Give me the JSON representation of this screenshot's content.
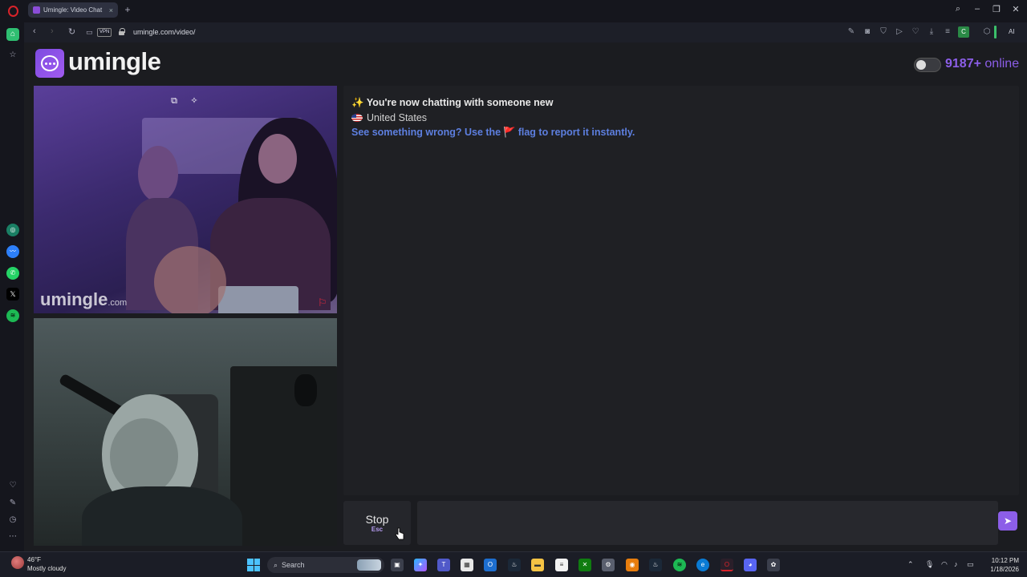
{
  "browser": {
    "tab_title": "Umingle: Video Chat",
    "tab_close": "×",
    "new_tab": "+",
    "vpn_label": "VPN",
    "url": "umingle.com/video/",
    "ext_badge": "C",
    "ai_label": "AI"
  },
  "header": {
    "logo_text": "umingle",
    "online_count": "9187+",
    "online_label": "online"
  },
  "video": {
    "watermark_main": "umingle",
    "watermark_suffix": ".com"
  },
  "chat": {
    "status_emoji": "✨",
    "status_text": "You're now chatting with someone new",
    "country": "United States",
    "report_text_before": "See something wrong? Use the",
    "report_flag": "🚩",
    "report_text_after": "flag to report it instantly."
  },
  "controls": {
    "stop_label": "Stop",
    "stop_key": "Esc",
    "message_placeholder": "",
    "message_value": ""
  },
  "taskbar": {
    "weather_temp": "46°F",
    "weather_desc": "Mostly cloudy",
    "search_label": "Search",
    "time": "10:12 PM",
    "date": "1/18/2026"
  },
  "colors": {
    "brand_purple": "#8c5ee8",
    "report_blue": "#5d7fe0",
    "flag_red": "#e0283b"
  }
}
